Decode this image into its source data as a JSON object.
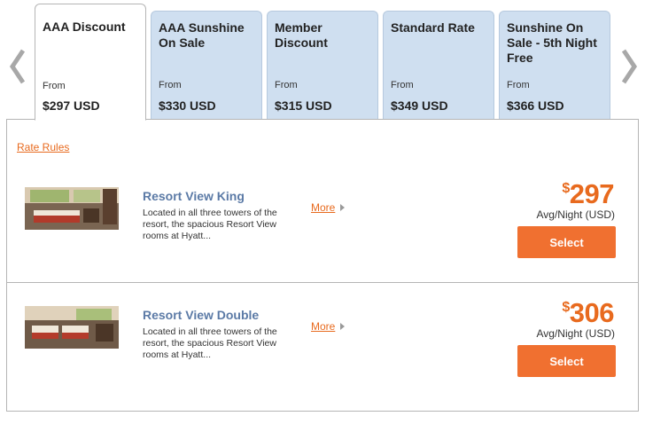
{
  "navigation": {
    "prev_icon": "chevron-left-icon",
    "next_icon": "chevron-right-icon"
  },
  "tabs": [
    {
      "name": "AAA Discount",
      "from": "From",
      "price": "$297 USD",
      "active": true
    },
    {
      "name": "AAA Sunshine On Sale",
      "from": "From",
      "price": "$330 USD"
    },
    {
      "name": "Member Discount",
      "from": "From",
      "price": "$315 USD"
    },
    {
      "name": "Standard Rate",
      "from": "From",
      "price": "$349 USD"
    },
    {
      "name": "Sunshine On Sale - 5th Night Free",
      "from": "From",
      "price": "$366 USD"
    }
  ],
  "panel": {
    "rate_rules": "Rate Rules",
    "rooms": [
      {
        "title": "Resort View King",
        "description": "Located in all three towers of the resort, the spacious Resort View rooms at Hyatt...",
        "more": "More",
        "currency_symbol": "$",
        "price": "297",
        "avg_label": "Avg/Night (USD)",
        "select": "Select"
      },
      {
        "title": "Resort View Double",
        "description": "Located in all three towers of the resort, the spacious Resort View rooms at Hyatt...",
        "more": "More",
        "currency_symbol": "$",
        "price": "306",
        "avg_label": "Avg/Night (USD)",
        "select": "Select"
      }
    ]
  },
  "colors": {
    "accent": "#f07030",
    "link": "#e86a1e",
    "room_title": "#5b7aa6",
    "tab_bg": "#cfdff0"
  }
}
